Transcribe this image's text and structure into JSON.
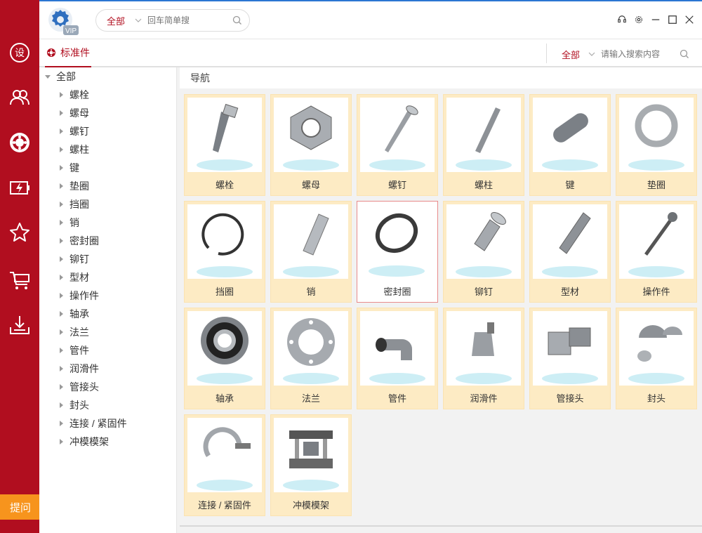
{
  "topbar": {
    "badge_text": "VIP",
    "search_scope": "全部",
    "search_placeholder": "回车简单搜"
  },
  "tabrow": {
    "active_tab": "标准件",
    "search_scope": "全部",
    "search_placeholder": "请输入搜索内容"
  },
  "rail": {
    "items": [
      "design-icon",
      "users-icon",
      "bearing-icon",
      "battery-icon",
      "star-icon",
      "cart-icon",
      "download-icon"
    ],
    "ask_label": "提问"
  },
  "tree": {
    "root": "全部",
    "items": [
      "螺栓",
      "螺母",
      "螺钉",
      "螺柱",
      "键",
      "垫圈",
      "挡圈",
      "销",
      "密封圈",
      "铆钉",
      "型材",
      "操作件",
      "轴承",
      "法兰",
      "管件",
      "润滑件",
      "管接头",
      "封头",
      "连接 / 紧固件",
      "冲模模架"
    ]
  },
  "main": {
    "nav_title": "导航",
    "cards": [
      "螺栓",
      "螺母",
      "螺钉",
      "螺柱",
      "键",
      "垫圈",
      "挡圈",
      "销",
      "密封圈",
      "铆钉",
      "型材",
      "操作件",
      "轴承",
      "法兰",
      "管件",
      "润滑件",
      "管接头",
      "封头",
      "连接 / 紧固件",
      "冲模模架"
    ],
    "selected_card": "密封圈"
  },
  "colors": {
    "rail": "#b10e1f",
    "accent": "#b10e1f",
    "card_bg": "#fdebc4",
    "ask_button": "#f7941d"
  }
}
